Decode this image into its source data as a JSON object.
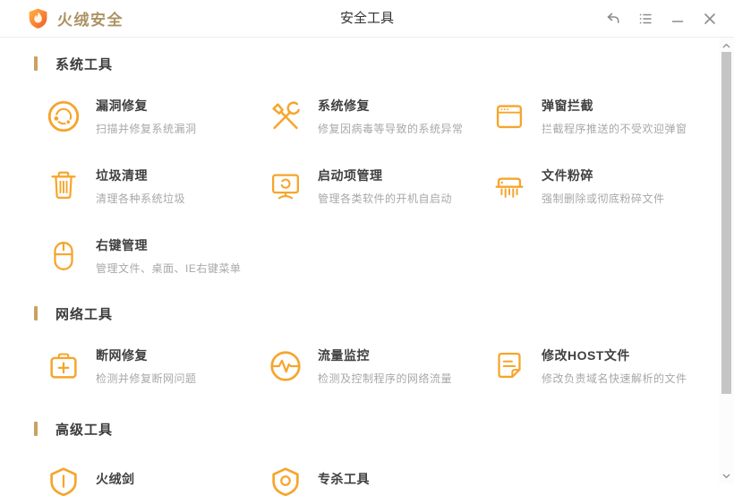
{
  "colors": {
    "accent": "#F6A52C",
    "section_bar": "#C9A263",
    "brand_text": "#AC9263",
    "item_title": "#404040",
    "item_desc": "#A8A8A8",
    "scrollbar_thumb": "#C5C5C5"
  },
  "window": {
    "brand": "火绒安全",
    "title": "安全工具",
    "controls": [
      {
        "name": "back",
        "icon": "back-arrow-icon"
      },
      {
        "name": "menu",
        "icon": "task-list-icon"
      },
      {
        "name": "minimize",
        "icon": "minimize-icon"
      },
      {
        "name": "close",
        "icon": "close-icon"
      }
    ]
  },
  "sections": [
    {
      "label": "系统工具",
      "items": [
        {
          "title": "漏洞修复",
          "desc": "扫描并修复系统漏洞",
          "icon": "vulnerability-scan-icon"
        },
        {
          "title": "系统修复",
          "desc": "修复因病毒等导致的系统异常",
          "icon": "repair-tools-icon"
        },
        {
          "title": "弹窗拦截",
          "desc": "拦截程序推送的不受欢迎弹窗",
          "icon": "popup-window-icon"
        },
        {
          "title": "垃圾清理",
          "desc": "清理各种系统垃圾",
          "icon": "trash-can-icon"
        },
        {
          "title": "启动项管理",
          "desc": "管理各类软件的开机自启动",
          "icon": "monitor-startup-icon"
        },
        {
          "title": "文件粉碎",
          "desc": "强制删除或彻底粉碎文件",
          "icon": "shredder-icon"
        },
        {
          "title": "右键管理",
          "desc": "管理文件、桌面、IE右键菜单",
          "icon": "mouse-icon"
        }
      ]
    },
    {
      "label": "网络工具",
      "items": [
        {
          "title": "断网修复",
          "desc": "检测并修复断网问题",
          "icon": "first-aid-kit-icon"
        },
        {
          "title": "流量监控",
          "desc": "检测及控制程序的网络流量",
          "icon": "pulse-circle-icon"
        },
        {
          "title": "修改HOST文件",
          "desc": "修改负责域名快速解析的文件",
          "icon": "document-icon"
        }
      ]
    },
    {
      "label": "高级工具",
      "items": [
        {
          "title": "火绒剑",
          "desc": "",
          "icon": "shield-icon"
        },
        {
          "title": "专杀工具",
          "desc": "",
          "icon": "shield-badge-icon"
        }
      ]
    }
  ]
}
